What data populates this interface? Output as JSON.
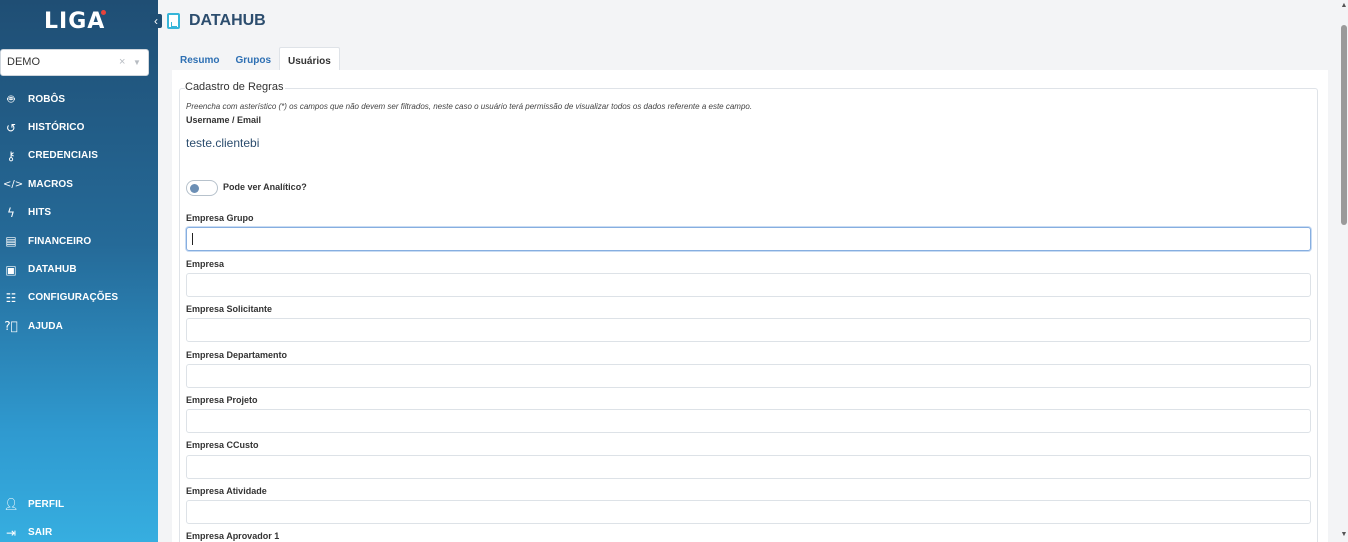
{
  "sidebar": {
    "logo": "LIGA",
    "org_select": {
      "value": "DEMO",
      "clear": "×",
      "caret": "▼"
    },
    "items": [
      {
        "label": "ROBÔS",
        "icon": "robot-icon"
      },
      {
        "label": "HISTÓRICO",
        "icon": "history-icon"
      },
      {
        "label": "CREDENCIAIS",
        "icon": "key-icon"
      },
      {
        "label": "MACROS",
        "icon": "code-icon"
      },
      {
        "label": "HITS",
        "icon": "bolt-icon"
      },
      {
        "label": "FINANCEIRO",
        "icon": "invoice-icon"
      },
      {
        "label": "DATAHUB",
        "icon": "file-chart-icon"
      },
      {
        "label": "CONFIGURAÇÕES",
        "icon": "sliders-icon"
      },
      {
        "label": "AJUDA",
        "icon": "help-icon"
      }
    ],
    "bottom_items": [
      {
        "label": "PERFIL",
        "icon": "user-icon"
      },
      {
        "label": "SAIR",
        "icon": "logout-icon"
      }
    ]
  },
  "header": {
    "title": "DATAHUB"
  },
  "tabs": [
    {
      "label": "Resumo",
      "active": false
    },
    {
      "label": "Grupos",
      "active": false
    },
    {
      "label": "Usuários",
      "active": true
    }
  ],
  "form": {
    "legend": "Cadastro de Regras",
    "hint": "Preencha com asterístico (*) os campos que não devem ser filtrados, neste caso o usuário terá permissão de visualizar todos os dados referente a este campo.",
    "username_label": "Username / Email",
    "username_value": "teste.clientebi",
    "toggle_label": "Pode ver Analítico?",
    "toggle_on": false,
    "fields": [
      {
        "label": "Empresa Grupo",
        "value": "",
        "focused": true
      },
      {
        "label": "Empresa",
        "value": ""
      },
      {
        "label": "Empresa Solicitante",
        "value": ""
      },
      {
        "label": "Empresa Departamento",
        "value": ""
      },
      {
        "label": "Empresa Projeto",
        "value": ""
      },
      {
        "label": "Empresa CCusto",
        "value": ""
      },
      {
        "label": "Empresa Atividade",
        "value": ""
      },
      {
        "label": "Empresa Aprovador 1"
      }
    ]
  }
}
